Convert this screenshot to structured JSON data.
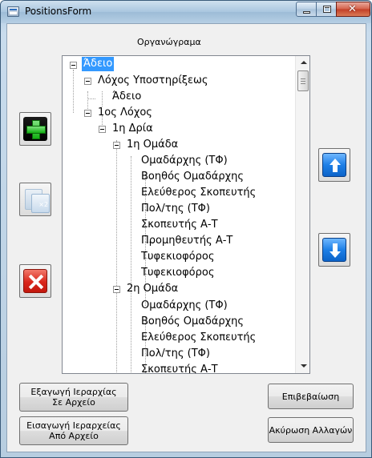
{
  "window": {
    "title": "PositionsForm",
    "controls": {
      "minimize": "minimize",
      "maximize": "maximize",
      "close": "✕"
    }
  },
  "header": {
    "label": "Οργανώγραμα"
  },
  "tree": {
    "nodes": [
      "Άδειο",
      "Λόχος Υποστηρίξεως",
      "Άδειο",
      "1ος Λόχος",
      "1η Δρία",
      "1η Ομάδα",
      "Ομαδάρχης (ΤΦ)",
      "Βοηθός Ομαδάρχης",
      "Ελεύθερος Σκοπευτής",
      "Πολ/της (ΤΦ)",
      "Σκοπευτής Α-Τ",
      "Προμηθευτής Α-Τ",
      "Τυφεκιοφόρος",
      "Τυφεκιοφόρος",
      "2η Ομάδα",
      "Ομαδάρχης (ΤΦ)",
      "Βοηθός Ομαδάρχης",
      "Ελεύθερος Σκοπευτής",
      "Πολ/της (ΤΦ)",
      "Σκοπευτής Α-Τ"
    ],
    "selected_index": 0
  },
  "side_buttons": {
    "add": "add-icon",
    "copy": "copy-x2-icon",
    "delete": "delete-icon",
    "move_up": "arrow-up-icon",
    "move_down": "arrow-down-icon"
  },
  "buttons": {
    "export": {
      "line1": "Εξαγωγή Ιεραρχίας",
      "line2": "Σε Αρχείο"
    },
    "import": {
      "line1": "Εισαγωγή Ιεραρχείας",
      "line2": "Από Αρχείο"
    },
    "confirm": "Επιβεβαίωση",
    "cancel": "Ακύρωση Αλλαγών"
  },
  "colors": {
    "selection": "#3399ff",
    "arrow_button": "#1e7fe6",
    "add": "#13b013",
    "delete": "#d9261a"
  }
}
